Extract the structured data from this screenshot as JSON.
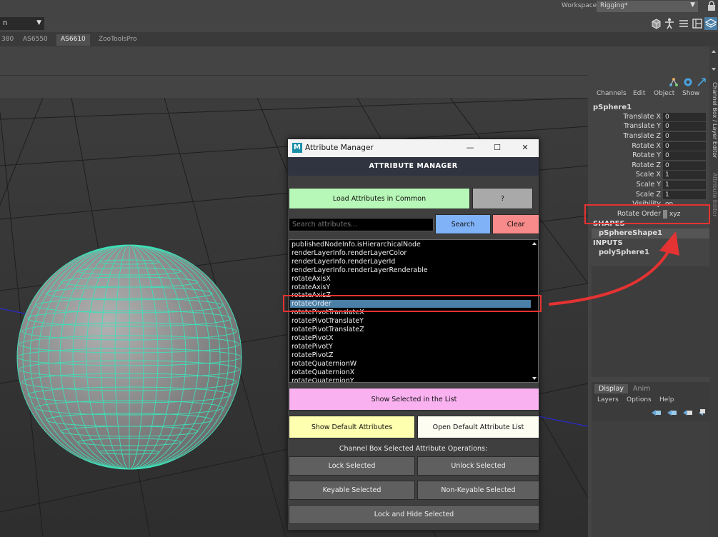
{
  "topbar": {
    "workspace_label": "Workspace:",
    "workspace_value": "Rigging*"
  },
  "mode_select": {
    "value": "n"
  },
  "shelf_tabs": [
    "380",
    "AS6550",
    "AS6610",
    "ZooToolsPro"
  ],
  "channel_box": {
    "vertical_tabs": [
      "Channel Box / Layer Editor",
      "Attribute Editor"
    ],
    "menu": [
      "Channels",
      "Edit",
      "Object",
      "Show"
    ],
    "object": "pSphere1",
    "channels": [
      {
        "label": "Translate X",
        "value": "0"
      },
      {
        "label": "Translate Y",
        "value": "0"
      },
      {
        "label": "Translate Z",
        "value": "0"
      },
      {
        "label": "Rotate X",
        "value": "0"
      },
      {
        "label": "Rotate Y",
        "value": "0"
      },
      {
        "label": "Rotate Z",
        "value": "0"
      },
      {
        "label": "Scale X",
        "value": "1"
      },
      {
        "label": "Scale Y",
        "value": "1"
      },
      {
        "label": "Scale Z",
        "value": "1"
      },
      {
        "label": "Visibility",
        "value": "on"
      }
    ],
    "rotate_order": {
      "label": "Rotate Order",
      "value": "xyz"
    },
    "shapes_label": "SHAPES",
    "shape_node": "pSphereShape1",
    "inputs_label": "INPUTS",
    "input_node": "polySphere1"
  },
  "layer_editor": {
    "tabs": [
      "Display",
      "Anim"
    ],
    "menu": [
      "Layers",
      "Options",
      "Help"
    ]
  },
  "dialog": {
    "title": "Attribute Manager",
    "header": "ATTRIBUTE MANAGER",
    "load_button": "Load Attributes in Common",
    "help_button": "?",
    "search_placeholder": "Search attributes...",
    "search_button": "Search",
    "clear_button": "Clear",
    "attributes": [
      "publishedNodeInfo.isHierarchicalNode",
      "renderLayerInfo.renderLayerColor",
      "renderLayerInfo.renderLayerId",
      "renderLayerInfo.renderLayerRenderable",
      "rotateAxisX",
      "rotateAxisY",
      "rotateAxisZ",
      "rotateOrder",
      "rotatePivotTranslateX",
      "rotatePivotTranslateY",
      "rotatePivotTranslateZ",
      "rotatePivotX",
      "rotatePivotY",
      "rotatePivotZ",
      "rotateQuaternionW",
      "rotateQuaternionX",
      "rotateQuaternionY"
    ],
    "selected_attribute": "rotateOrder",
    "show_selected_button": "Show Selected in the List",
    "show_default_button": "Show Default Attributes",
    "open_default_button": "Open Default Attribute List",
    "ops_label": "Channel Box Selected Attribute Operations:",
    "lock_button": "Lock Selected",
    "unlock_button": "Unlock Selected",
    "keyable_button": "Keyable Selected",
    "nonkeyable_button": "Non-Keyable Selected",
    "lock_hide_button": "Lock and Hide Selected"
  },
  "colors": {
    "load_button": "#b7f7b7",
    "help_button": "#a9a9a9",
    "search_button": "#7fb2f7",
    "clear_button": "#f78a8a",
    "show_selected_button": "#f9b1f0",
    "show_default_button": "#ffffb0",
    "open_default_button": "#fdfdf2",
    "ops_button": "#5f5f5f",
    "highlight": "#e53232",
    "wireframe": "#3ee0b8"
  }
}
